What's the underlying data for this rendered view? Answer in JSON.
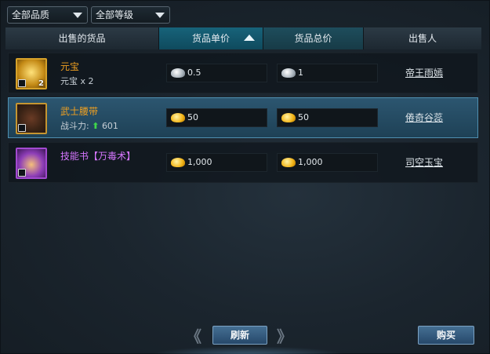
{
  "filters": {
    "quality": "全部品质",
    "level": "全部等级"
  },
  "columns": {
    "goods": "出售的货品",
    "unit_price": "货品单价",
    "total_price": "货品总价",
    "seller": "出售人"
  },
  "rows": [
    {
      "name": "元宝",
      "name_color": "#f0a020",
      "sub_label": "元宝",
      "sub_value": "x 2",
      "quantity": "2",
      "unit_price": "0.5",
      "unit_currency": "silver",
      "total_price": "1",
      "total_currency": "silver",
      "seller": "帝王雨嫣",
      "icon": "gold-ingot-icon"
    },
    {
      "name": "武士腰带",
      "name_color": "#f0a020",
      "sub_label": "战斗力:",
      "sub_value": "601",
      "unit_price": "50",
      "unit_currency": "gold",
      "total_price": "50",
      "total_currency": "gold",
      "seller": "倦奇谷蕊",
      "icon": "belt-icon"
    },
    {
      "name": "技能书【万毒术】",
      "name_color": "#d676ff",
      "unit_price": "1,000",
      "unit_currency": "gold",
      "total_price": "1,000",
      "total_currency": "gold",
      "seller": "司空玉宝",
      "icon": "skill-book-icon"
    }
  ],
  "buttons": {
    "refresh": "刷新",
    "buy": "购买",
    "prev": "《",
    "next": "》"
  },
  "colors": {
    "header_active": "#17637a",
    "selected_row": "#2c5670",
    "power_up_arrow": "#3fd64b"
  }
}
